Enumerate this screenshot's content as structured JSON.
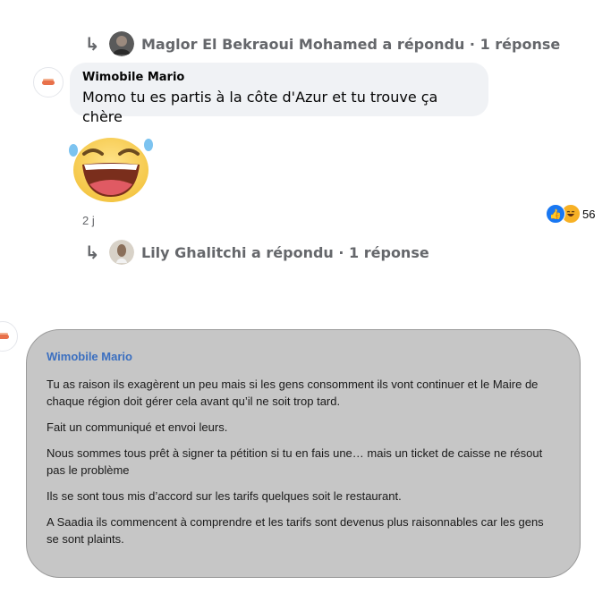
{
  "replies": [
    {
      "author_text": "Maglor El Bekraoui Mohamed a répondu · 1 réponse"
    },
    {
      "author_text": "Lily Ghalitchi a répondu · 1 réponse"
    }
  ],
  "comment": {
    "author": "Wimobile Mario",
    "text": "Momo tu es partis à la côte d'Azur et tu trouve ça chère",
    "timestamp": "2 j",
    "sticker": "laughing-tears-emoji",
    "reactions": {
      "icons": [
        "like-icon",
        "haha-icon"
      ],
      "count": "56"
    }
  },
  "card": {
    "author": "Wimobile Mario",
    "paragraphs": [
      "Tu as raison ils exagèrent un peu mais si les gens consomment ils vont continuer et le Maire de chaque région doit gérer cela avant qu’il ne soit trop tard.",
      "Fait un communiqué et envoi leurs.",
      "Nous sommes tous prêt à signer ta pétition si tu en fais une… mais un ticket de caisse ne résout pas le problème",
      "Ils se sont tous mis d’accord sur les tarifs quelques soit le restaurant.",
      "A Saadia ils commencent à comprendre et les tarifs sont devenus plus raisonnables car les gens se sont plaints."
    ]
  },
  "colors": {
    "card_bg": "#c6c6c6",
    "card_name": "#3b6fc0",
    "bubble_bg": "#f0f2f5",
    "like_blue": "#1877f2"
  }
}
